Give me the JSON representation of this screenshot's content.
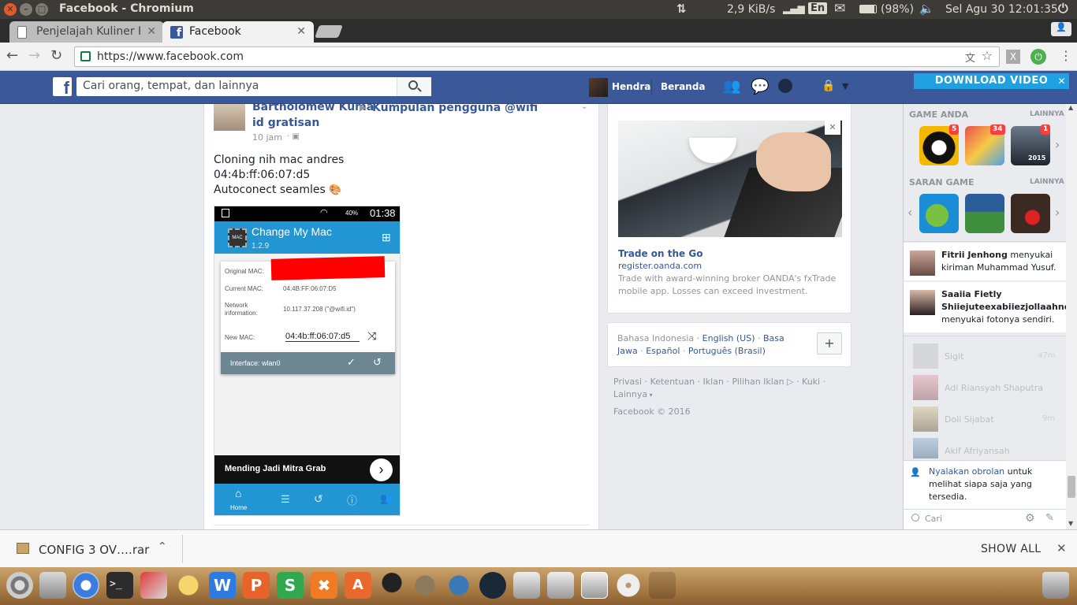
{
  "panel": {
    "window_title": "Facebook - Chromium",
    "net_speed": "2,9 KiB/s",
    "keyboard": "En",
    "battery": "(98%)",
    "datetime": "Sel Agu 30 12:01:35"
  },
  "tabs": [
    {
      "title": "Penjelajah Kuliner I",
      "active": false
    },
    {
      "title": "Facebook",
      "active": true
    }
  ],
  "omnibox": {
    "url": "https://www.facebook.com"
  },
  "fb_header": {
    "search_placeholder": "Cari orang, tempat, dan lainnya",
    "profile_name": "Hendra",
    "home_label": "Beranda",
    "download_video": "DOWNLOAD VIDEO"
  },
  "post": {
    "author": "Bartholomew Kuma",
    "group": "Kumpulan pengguna @wifi id gratisan",
    "time": "10 jam",
    "lines": [
      "Cloning nih mac andres",
      "04:4b:ff:06:07:d5",
      "Autoconect seamles"
    ],
    "screenshot": {
      "status_battery": "40%",
      "status_time": "01:38",
      "app_name": "Change My Mac",
      "app_version": "1.2.9",
      "chip_label": "MAC",
      "original_mac_label": "Original MAC:",
      "current_mac_label": "Current MAC:",
      "current_mac": "04:4B:FF:06:07:D5",
      "network_label": "Network information:",
      "network_value": "10.117.37.208 (\"@wifi.id\")",
      "new_mac_label": "New MAC:",
      "new_mac": "04:4b:ff:06:07:d5",
      "interface": "Interface: wlan0",
      "ad_text": "Mending Jadi Mitra Grab",
      "home_label": "Home"
    }
  },
  "ad": {
    "title": "Trade on the Go",
    "domain": "register.oanda.com",
    "body": "Trade with award-winning broker OANDA's fxTrade mobile app. Losses can exceed investment."
  },
  "languages": {
    "current": "Bahasa Indonesia",
    "items": [
      "English (US)",
      "Basa Jawa",
      "Español",
      "Português (Brasil)"
    ]
  },
  "footer": {
    "links": [
      "Privasi",
      "Ketentuan",
      "Iklan",
      "Pilihan Iklan",
      "Kuki",
      "Lainnya"
    ],
    "copyright": "Facebook © 2016"
  },
  "chat": {
    "your_games": "GAME ANDA",
    "more": "LAINNYA",
    "suggested_games": "SARAN GAME",
    "game_badges": [
      "5",
      "34",
      "1"
    ],
    "game_year": "2015",
    "ticker": [
      {
        "name": "Fitrii Jenhong",
        "text": " menyukai kiriman Muhammad Yusuf."
      },
      {
        "name": "Saaiia Fietly Shiiejuteexabiiezjollaahne",
        "text": " menyukai fotonya sendiri."
      }
    ],
    "contacts": [
      {
        "name": "Sigit",
        "time": "47m"
      },
      {
        "name": "Adi Riansyah Shaputra",
        "time": ""
      },
      {
        "name": "Doli Sijabat",
        "time": "9m"
      },
      {
        "name": "Akif Afriyansah",
        "time": ""
      }
    ],
    "enable_link": "Nyalakan obrolan",
    "enable_rest": " untuk melihat siapa saja yang tersedia.",
    "search_placeholder": "Cari"
  },
  "download_bar": {
    "file": "CONFIG 3 OV….rar",
    "show_all": "SHOW ALL"
  },
  "colors": {
    "fb_blue": "#3b5998",
    "link_blue": "#365899",
    "app_blue": "#2196d3",
    "redaction_red": "#ff0000"
  }
}
